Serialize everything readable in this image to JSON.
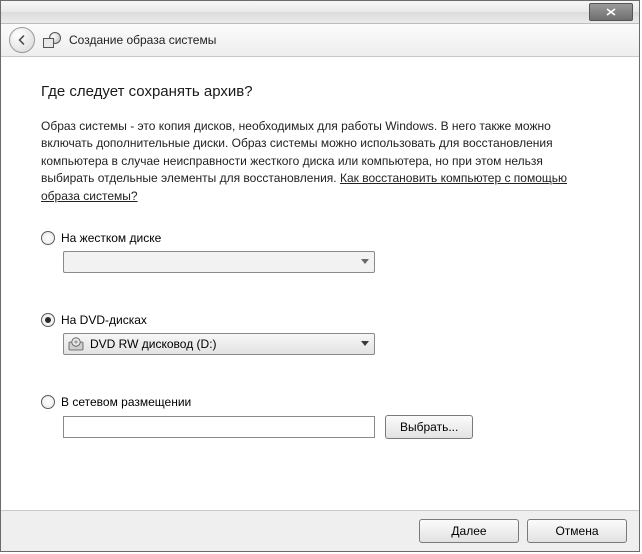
{
  "header": {
    "title": "Создание образа системы"
  },
  "content": {
    "heading": "Где следует сохранять архив?",
    "description_part1": "Образ системы - это копия дисков, необходимых для работы Windows. В него также можно включать дополнительные диски. Образ системы можно использовать для восстановления компьютера в случае неисправности жесткого диска или компьютера, но при этом нельзя выбирать отдельные элементы для восстановления. ",
    "help_link": "Как восстановить компьютер с помощью образа системы?"
  },
  "options": {
    "hard_disk": {
      "label": "На жестком диске",
      "checked": false,
      "combo_value": ""
    },
    "dvd": {
      "label": "На DVD-дисках",
      "checked": true,
      "combo_value": "DVD RW дисковод (D:)"
    },
    "network": {
      "label": "В сетевом размещении",
      "checked": false,
      "path_value": "",
      "browse_label": "Выбрать..."
    }
  },
  "footer": {
    "next": "Далее",
    "cancel": "Отмена"
  }
}
